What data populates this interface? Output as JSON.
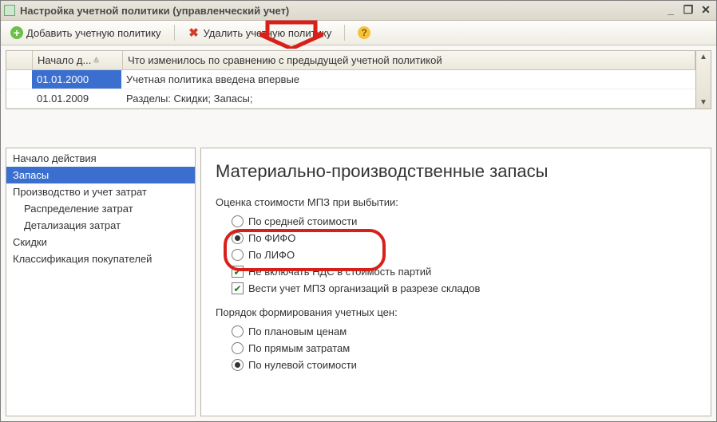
{
  "window": {
    "title": "Настройка учетной политики (управленческий учет)"
  },
  "toolbar": {
    "add_label": "Добавить учетную политику",
    "delete_label": "Удалить учетную политику"
  },
  "table": {
    "headers": {
      "col1": "Начало д...",
      "col2": "Что изменилось по сравнению с предыдущей учетной политикой"
    },
    "rows": [
      {
        "date": "01.01.2000",
        "text": "Учетная политика введена впервые",
        "selected": true
      },
      {
        "date": "01.01.2009",
        "text": "Разделы: Скидки; Запасы;",
        "selected": false
      }
    ]
  },
  "nav": {
    "items": [
      {
        "label": "Начало действия",
        "indent": false
      },
      {
        "label": "Запасы",
        "indent": false,
        "selected": true
      },
      {
        "label": "Производство и учет затрат",
        "indent": false
      },
      {
        "label": "Распределение затрат",
        "indent": true
      },
      {
        "label": "Детализация затрат",
        "indent": true
      },
      {
        "label": "Скидки",
        "indent": false
      },
      {
        "label": "Классификация покупателей",
        "indent": false
      }
    ]
  },
  "panel": {
    "title": "Материально-производственные запасы",
    "group1_label": "Оценка стоимости МПЗ при выбытии:",
    "options1": [
      {
        "label": "По средней стоимости",
        "selected": false
      },
      {
        "label": "По ФИФО",
        "selected": true
      },
      {
        "label": "По ЛИФО",
        "selected": false
      }
    ],
    "checks": [
      {
        "label": "Не включать НДС в стоимость партий",
        "checked": true
      },
      {
        "label": "Вести учет МПЗ организаций в разрезе складов",
        "checked": true
      }
    ],
    "group2_label": "Порядок формирования учетных цен:",
    "options2": [
      {
        "label": "По плановым ценам",
        "selected": false
      },
      {
        "label": "По прямым затратам",
        "selected": false
      },
      {
        "label": "По нулевой стоимости",
        "selected": true
      }
    ]
  }
}
